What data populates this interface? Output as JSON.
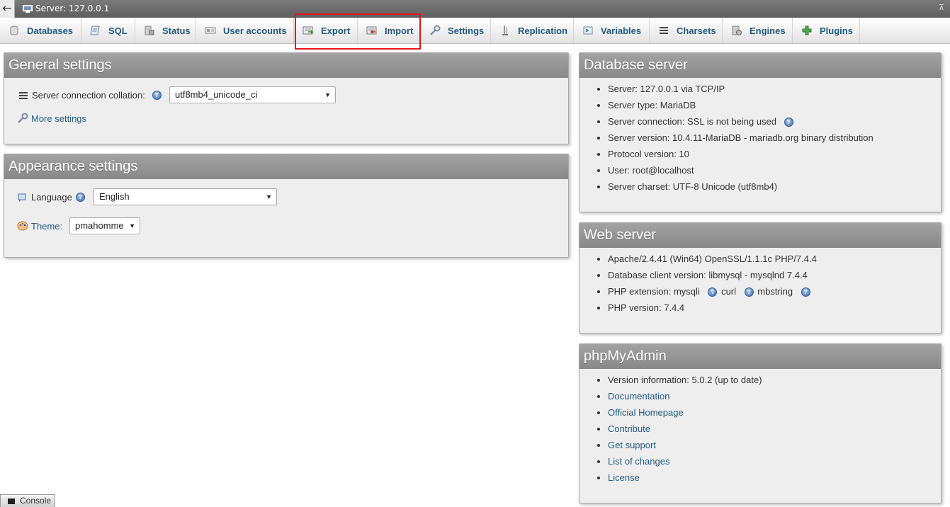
{
  "serverbar": {
    "breadcrumb": "Server: 127.0.0.1",
    "back_icon": "←",
    "collapse_icon": "⊼"
  },
  "tabs": [
    {
      "label": "Databases",
      "icon": "database-icon"
    },
    {
      "label": "SQL",
      "icon": "sql-icon"
    },
    {
      "label": "Status",
      "icon": "status-icon"
    },
    {
      "label": "User accounts",
      "icon": "user-accounts-icon"
    },
    {
      "label": "Export",
      "icon": "export-icon"
    },
    {
      "label": "Import",
      "icon": "import-icon"
    },
    {
      "label": "Settings",
      "icon": "wrench-icon"
    },
    {
      "label": "Replication",
      "icon": "replication-icon"
    },
    {
      "label": "Variables",
      "icon": "variables-icon"
    },
    {
      "label": "Charsets",
      "icon": "charsets-icon"
    },
    {
      "label": "Engines",
      "icon": "engines-icon"
    },
    {
      "label": "Plugins",
      "icon": "plugins-icon"
    }
  ],
  "general_settings": {
    "title": "General settings",
    "collation_label": "Server connection collation:",
    "collation_value": "utf8mb4_unicode_ci",
    "more_settings": "More settings"
  },
  "appearance_settings": {
    "title": "Appearance settings",
    "language_label": "Language",
    "language_value": "English",
    "theme_label": "Theme:",
    "theme_value": "pmahomme"
  },
  "database_server": {
    "title": "Database server",
    "items": [
      "Server: 127.0.0.1 via TCP/IP",
      "Server type: MariaDB",
      "Server connection: SSL is not being used",
      "Server version: 10.4.11-MariaDB - mariadb.org binary distribution",
      "Protocol version: 10",
      "User: root@localhost",
      "Server charset: UTF-8 Unicode (utf8mb4)"
    ]
  },
  "web_server": {
    "title": "Web server",
    "item0": "Apache/2.4.41 (Win64) OpenSSL/1.1.1c PHP/7.4.4",
    "item1": "Database client version: libmysql - mysqlnd 7.4.4",
    "php_ext_prefix": "PHP extension: mysqli",
    "php_ext_curl": "curl",
    "php_ext_mbstring": "mbstring",
    "item3": "PHP version: 7.4.4"
  },
  "phpmyadmin": {
    "title": "phpMyAdmin",
    "version": "Version information: 5.0.2 (up to date)",
    "links": [
      "Documentation",
      "Official Homepage",
      "Contribute",
      "Get support",
      "List of changes",
      "License"
    ]
  },
  "console": {
    "label": "Console"
  },
  "colors": {
    "link": "#235a81",
    "highlight": "#e4141b",
    "header_grey": "#888888"
  }
}
